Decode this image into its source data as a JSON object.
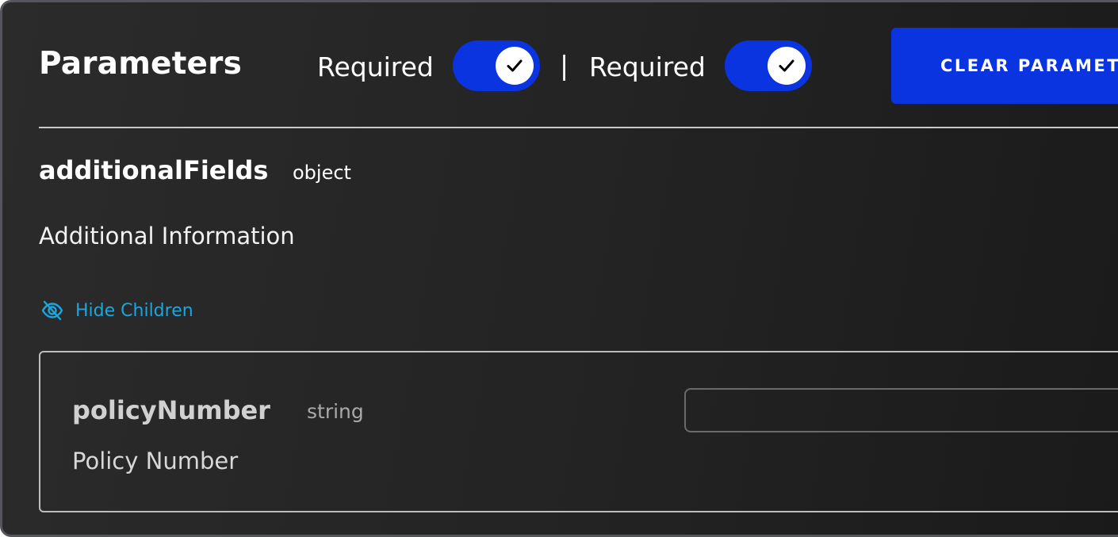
{
  "header": {
    "title": "Parameters",
    "required_label_1": "Required",
    "required_toggle_1": true,
    "separator": "|",
    "required_label_2": "Required",
    "required_toggle_2": true,
    "clear_button_label": "CLEAR PARAMETERS"
  },
  "parameter": {
    "name": "additionalFields",
    "type": "object",
    "description": "Additional Information",
    "toggle_children_label": "Hide Children",
    "children": [
      {
        "name": "policyNumber",
        "type": "string",
        "description": "Policy Number",
        "value": ""
      }
    ]
  },
  "icons": {
    "toggle_knob": "check-icon",
    "hide_children": "eye-off-icon"
  },
  "colors": {
    "accent_blue": "#0a34e0",
    "link_cyan": "#1aa7e0",
    "panel_bg": "#262626"
  }
}
